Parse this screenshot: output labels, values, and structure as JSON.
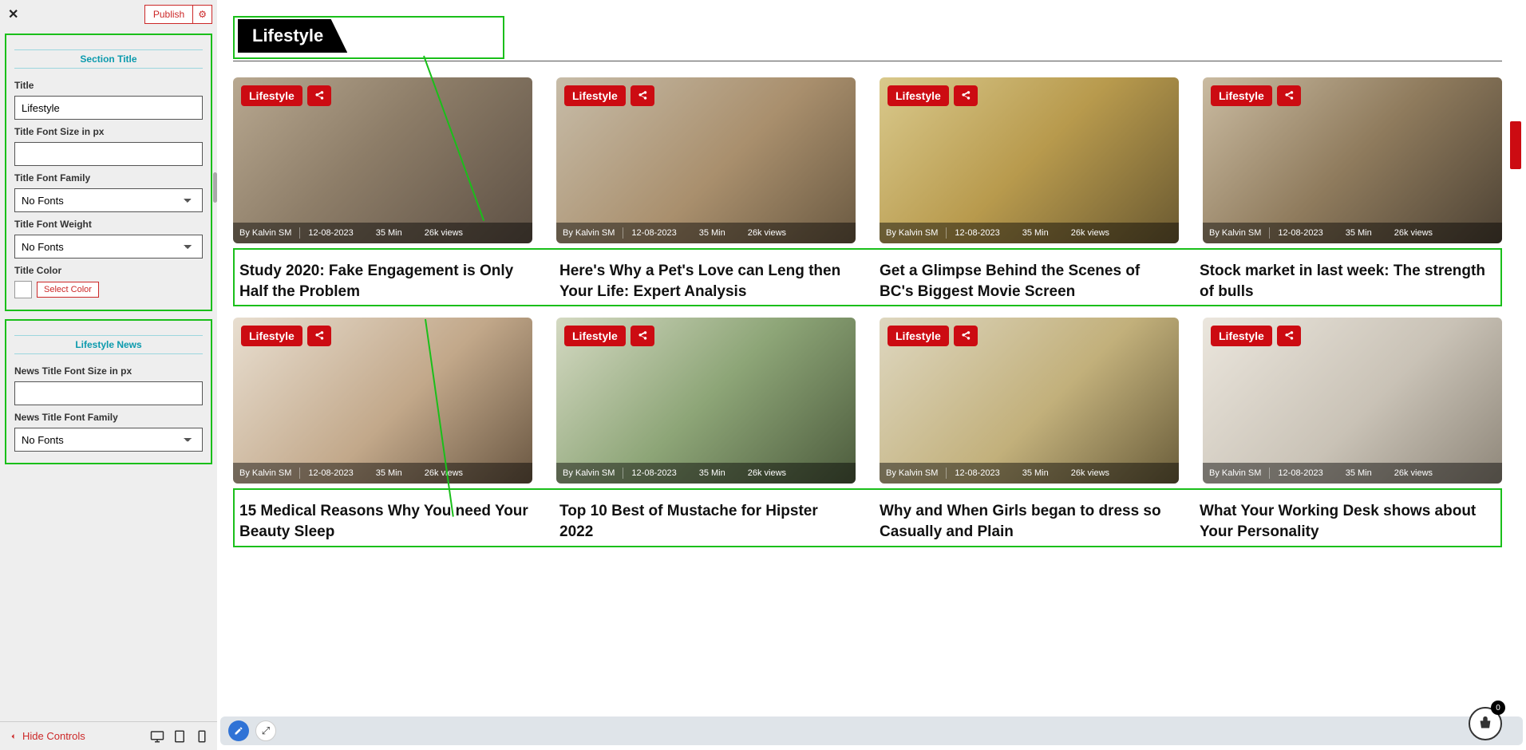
{
  "sidebar": {
    "publish_label": "Publish",
    "section_title_header": "Section Title",
    "labels": {
      "title": "Title",
      "title_font_size": "Title Font Size in px",
      "title_font_family": "Title Font Family",
      "title_font_weight": "Title Font Weight",
      "title_color": "Title Color",
      "select_color": "Select Color"
    },
    "values": {
      "title": "Lifestyle",
      "title_font_size": "",
      "font_family": "No Fonts",
      "font_weight": "No Fonts"
    },
    "lifestyle_header": "Lifestyle News",
    "lifestyle_labels": {
      "news_title_font_size": "News Title Font Size in px",
      "news_title_font_family": "News Title Font Family"
    },
    "lifestyle_values": {
      "news_font_size": "",
      "news_font_family": "No Fonts"
    },
    "hide_controls": "Hide Controls"
  },
  "main": {
    "section_title": "Lifestyle",
    "category_badge": "Lifestyle",
    "meta": {
      "author": "By Kalvin SM",
      "date": "12-08-2023",
      "read": "35 Min",
      "views": "26k views"
    },
    "cards_row1": [
      {
        "title": "Study 2020: Fake Engagement is Only Half the Problem "
      },
      {
        "title": "Here's Why a Pet's Love can Leng then Your Life: Expert Analysis"
      },
      {
        "title": "Get a Glimpse Behind the Scenes of BC's Biggest Movie Screen"
      },
      {
        "title": "Stock market in last week: The strength of bulls"
      }
    ],
    "cards_row2": [
      {
        "title": "15 Medical Reasons Why You need Your Beauty Sleep"
      },
      {
        "title": "Top 10 Best of Mustache for Hipster 2022"
      },
      {
        "title": "Why and When Girls began to dress so Casually and Plain"
      },
      {
        "title": "What Your Working Desk shows about Your Personality"
      }
    ],
    "basket_count": "0"
  }
}
